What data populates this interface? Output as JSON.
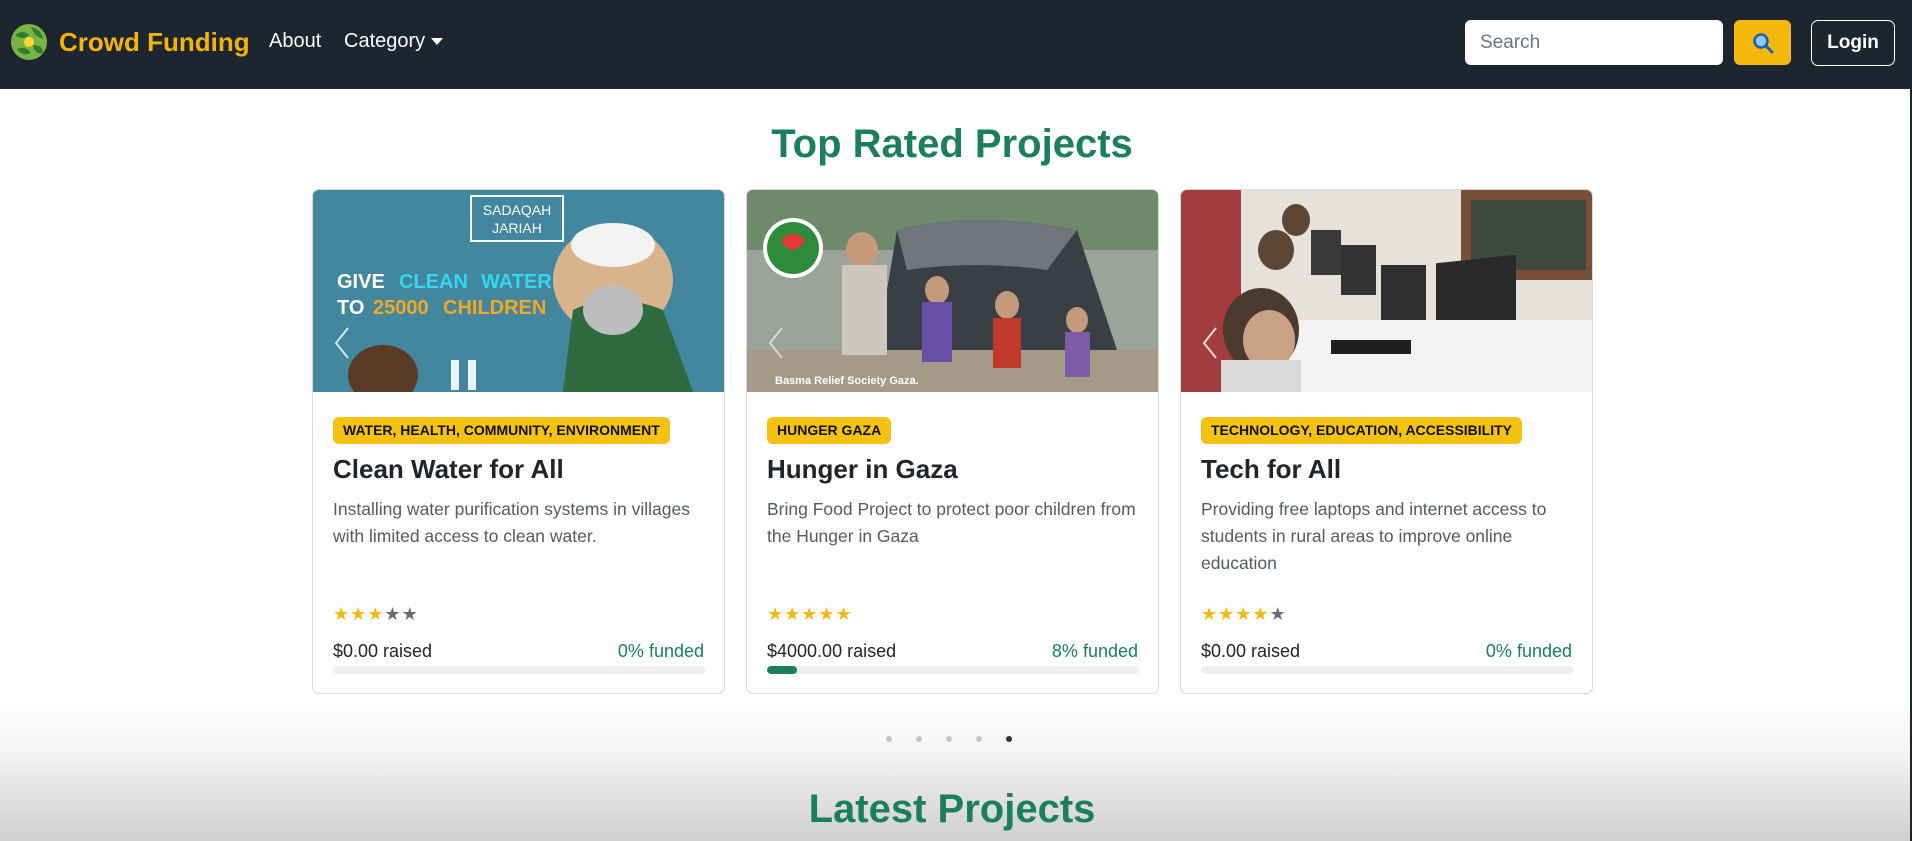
{
  "navbar": {
    "brand": "Crowd Funding",
    "about": "About",
    "category": "Category",
    "search_placeholder": "Search",
    "login": "Login"
  },
  "sections": {
    "top_rated": "Top Rated Projects",
    "latest": "Latest Projects"
  },
  "projects": [
    {
      "categories": "WATER, HEALTH, COMMUNITY, ENVIRONMENT",
      "title": "Clean Water for All",
      "description": "Installing water purification systems in villages with limited access to clean water.",
      "rating": 3,
      "raised": "$0.00 raised",
      "funded": "0% funded",
      "progress": 0,
      "image_text": {
        "line1": "SADAQAH",
        "line2": "JARIAH",
        "give": "GIVE",
        "clean": "CLEAN",
        "water": "WATER",
        "to": "TO",
        "count": "25000",
        "children": "CHILDREN"
      }
    },
    {
      "categories": "HUNGER GAZA",
      "title": "Hunger in Gaza",
      "description": "Bring Food Project to protect poor children from the Hunger in Gaza",
      "rating": 5,
      "raised": "$4000.00 raised",
      "funded": "8% funded",
      "progress": 8,
      "image_text": {
        "caption": "Basma Relief Society Gaza."
      }
    },
    {
      "categories": "TECHNOLOGY, EDUCATION, ACCESSIBILITY",
      "title": "Tech for All",
      "description": "Providing free laptops and internet access to students in rural areas to improve online education",
      "rating": 4,
      "raised": "$0.00 raised",
      "funded": "0% funded",
      "progress": 0
    }
  ],
  "carousel": {
    "slide_count": 5,
    "active_index": 4
  },
  "colors": {
    "navbar_bg": "#1c2530",
    "brand": "#f5b400",
    "accent_green": "#1c7f5b",
    "badge_yellow": "#f5c212",
    "search_button": "#f5b90d"
  },
  "icons": {
    "logo": "globe-leaf-icon",
    "search": "magnifier-icon",
    "prev": "chevron-left-icon"
  }
}
